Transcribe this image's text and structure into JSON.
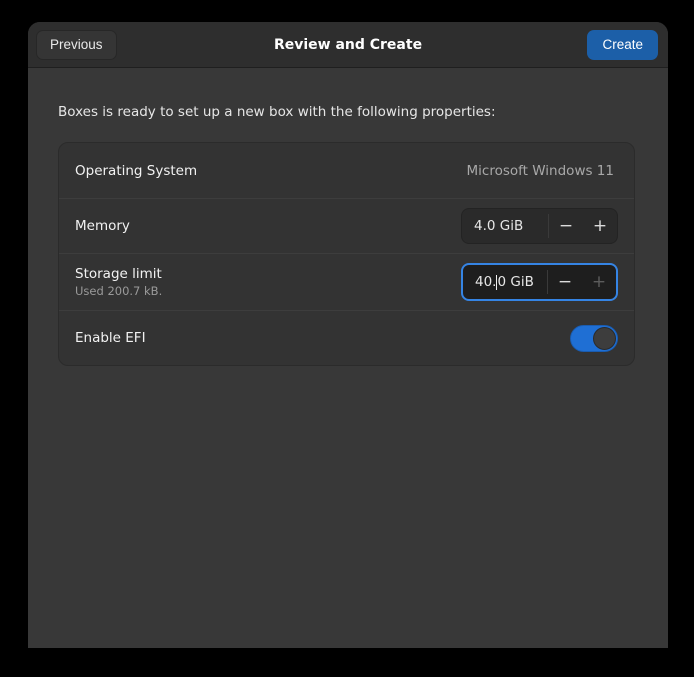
{
  "window": {
    "title": "Review and Create"
  },
  "header": {
    "previous_label": "Previous",
    "create_label": "Create"
  },
  "content": {
    "intro": "Boxes is ready to set up a new box with the following properties:"
  },
  "properties": {
    "operating_system": {
      "label": "Operating System",
      "value": "Microsoft Windows 11"
    },
    "memory": {
      "label": "Memory",
      "value": "4.0 GiB",
      "decrement": "−",
      "increment": "+"
    },
    "storage_limit": {
      "label": "Storage limit",
      "subtitle": "Used 200.7 kB.",
      "value_before_caret": "40.",
      "value_after_caret": "0 GiB",
      "value": "40.0 GiB",
      "decrement": "−",
      "increment": "+"
    },
    "enable_efi": {
      "label": "Enable EFI",
      "state": "on"
    }
  },
  "colors": {
    "page_background": "#000000",
    "window_background": "#383838",
    "headerbar": "#2e2e2e",
    "card": "#333333",
    "accent_blue": "#1c5fa8",
    "switch_on": "#1f6fd4",
    "focus_ring": "#3584e4"
  }
}
